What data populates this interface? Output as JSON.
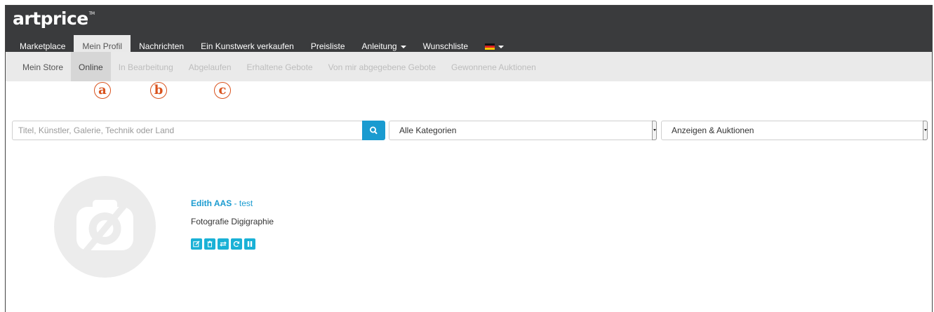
{
  "brand": {
    "name": "artprice",
    "tm": "TM"
  },
  "nav": {
    "items": [
      {
        "label": "Marketplace"
      },
      {
        "label": "Mein Profil"
      },
      {
        "label": "Nachrichten"
      },
      {
        "label": "Ein Kunstwerk verkaufen"
      },
      {
        "label": "Preisliste"
      },
      {
        "label": "Anleitung"
      },
      {
        "label": "Wunschliste"
      }
    ],
    "active_index": 1,
    "flag_icon": "german-flag-icon"
  },
  "subnav": {
    "items": [
      {
        "label": "Mein Store"
      },
      {
        "label": "Online"
      },
      {
        "label": "In Bearbeitung"
      },
      {
        "label": "Abgelaufen"
      },
      {
        "label": "Erhaltene Gebote"
      },
      {
        "label": "Von mir abgegebene Gebote"
      },
      {
        "label": "Gewonnene Auktionen"
      }
    ],
    "active_index": 1
  },
  "annotations": [
    "a",
    "b",
    "c"
  ],
  "search": {
    "placeholder": "Titel, Künstler, Galerie, Technik oder Land",
    "value": "",
    "button_icon": "search-icon"
  },
  "filters": {
    "category": "Alle Kategorien",
    "type": "Anzeigen & Auktionen"
  },
  "listing": {
    "artist": "Edith AAS",
    "separator": " - ",
    "title": "test",
    "medium": "Fotografie Digigraphie",
    "actions": [
      "edit-icon",
      "delete-icon",
      "transfer-icon",
      "refresh-icon",
      "pause-icon"
    ]
  },
  "colors": {
    "topbar": "#3a3b3d",
    "accent": "#1a9bd0",
    "annotation": "#d9531e"
  }
}
